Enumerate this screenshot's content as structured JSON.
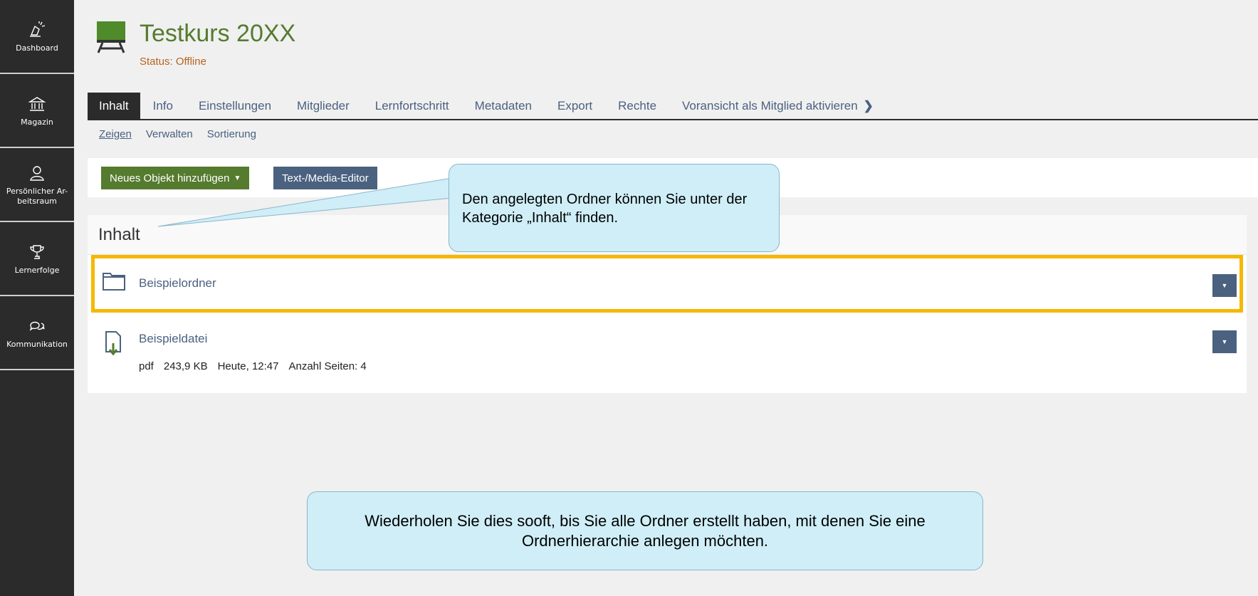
{
  "sidebar": {
    "items": [
      {
        "label": "Dashboard",
        "icon": "dashboard-icon"
      },
      {
        "label": "Magazin",
        "icon": "bank-icon"
      },
      {
        "label": "Persönlicher Ar-\nbeitsraum",
        "icon": "user-icon"
      },
      {
        "label": "Lernerfolge",
        "icon": "trophy-icon"
      },
      {
        "label": "Kommunikation",
        "icon": "chat-icon"
      }
    ]
  },
  "header": {
    "title": "Testkurs 20XX",
    "status": "Status: Offline"
  },
  "tabs": [
    "Inhalt",
    "Info",
    "Einstellungen",
    "Mitglieder",
    "Lernfortschritt",
    "Metadaten",
    "Export",
    "Rechte",
    "Voransicht als Mitglied aktivieren"
  ],
  "subtabs": [
    "Zeigen",
    "Verwalten",
    "Sortierung"
  ],
  "toolbar": {
    "add_label": "Neues Objekt hinzufügen",
    "editor_label": "Text-/Media-Editor"
  },
  "content": {
    "title": "Inhalt",
    "items": [
      {
        "title": "Beispielordner",
        "icon": "folder-icon"
      },
      {
        "title": "Beispieldatei",
        "icon": "file-download-icon",
        "meta": [
          "pdf",
          "243,9 KB",
          "Heute, 12:47",
          "Anzahl Seiten: 4"
        ]
      }
    ]
  },
  "callouts": {
    "top": "Den angelegten Ordner können Sie unter der Kategorie „Inhalt“ finden.",
    "bottom": "Wiederholen Sie dies sooft, bis Sie alle Ordner erstellt haben, mit denen Sie eine Ordnerhierarchie anlegen möchten."
  },
  "colors": {
    "accent_green": "#557b2e",
    "link_blue": "#4b6180",
    "status_orange": "#b8631e",
    "highlight": "#f5b800",
    "callout_bg": "#cfeef7"
  }
}
